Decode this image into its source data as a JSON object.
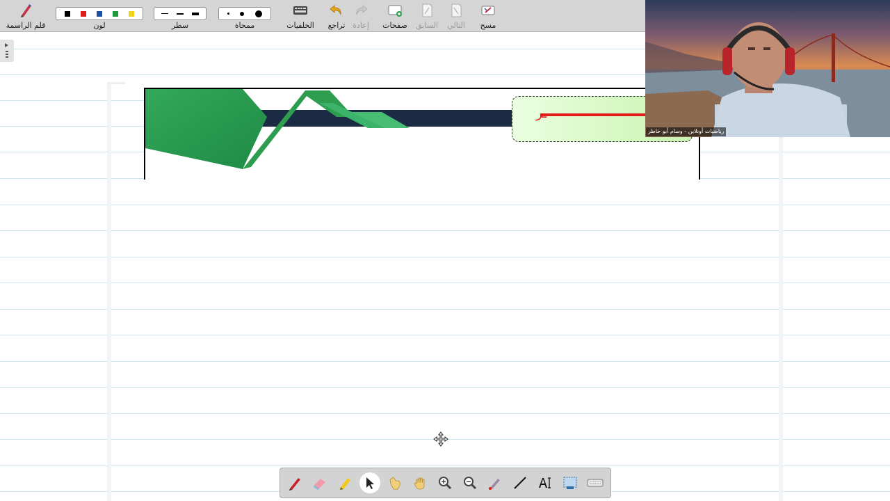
{
  "toolbar": {
    "pen": {
      "label": "قلم الراسمة",
      "icon": "pen-icon"
    },
    "color": {
      "label": "لون",
      "swatches": [
        "#000000",
        "#e01b1b",
        "#1b4fa0",
        "#1e9a3a",
        "#f2d21a"
      ]
    },
    "line": {
      "label": "سطر"
    },
    "eraser": {
      "label": "ممحاة"
    },
    "backgrounds": {
      "label": "الخلفيات",
      "icon": "keyboard-icon"
    },
    "undo": {
      "label": "تراجع",
      "icon": "undo-icon"
    },
    "redo": {
      "label": "إعادة",
      "icon": "redo-icon"
    },
    "pages": {
      "label": "صفحات",
      "icon": "add-page-icon"
    },
    "previous": {
      "label": "السابق",
      "icon": "previous-page-icon"
    },
    "next": {
      "label": "التالي",
      "icon": "next-page-icon"
    },
    "clear": {
      "label": "مسح",
      "icon": "clear-icon"
    }
  },
  "video": {
    "caption": "رياضيات أونلاين - وسام أبو خاطر"
  },
  "slide": {
    "title_fragment": "ـر",
    "colors": {
      "green": "#2e9d4f",
      "navy": "#1c2b44",
      "red": "#e31b1b"
    }
  },
  "bottom_tools": [
    {
      "name": "red-pen-tool",
      "icon": "red-pen-icon"
    },
    {
      "name": "eraser-tool",
      "icon": "eraser-icon"
    },
    {
      "name": "highlighter-tool",
      "icon": "highlighter-icon"
    },
    {
      "name": "select-tool",
      "icon": "arrow-cursor-icon",
      "active": true
    },
    {
      "name": "pointer-tool",
      "icon": "pointing-hand-icon"
    },
    {
      "name": "pan-tool",
      "icon": "hand-icon"
    },
    {
      "name": "zoom-in-tool",
      "icon": "zoom-in-icon"
    },
    {
      "name": "zoom-out-tool",
      "icon": "zoom-out-icon"
    },
    {
      "name": "laser-tool",
      "icon": "laser-pen-icon"
    },
    {
      "name": "line-tool",
      "icon": "line-icon"
    },
    {
      "name": "text-tool",
      "icon": "text-icon"
    },
    {
      "name": "screen-capture-tool",
      "icon": "screen-capture-icon"
    },
    {
      "name": "keyboard-tool",
      "icon": "keyboard-icon"
    }
  ]
}
